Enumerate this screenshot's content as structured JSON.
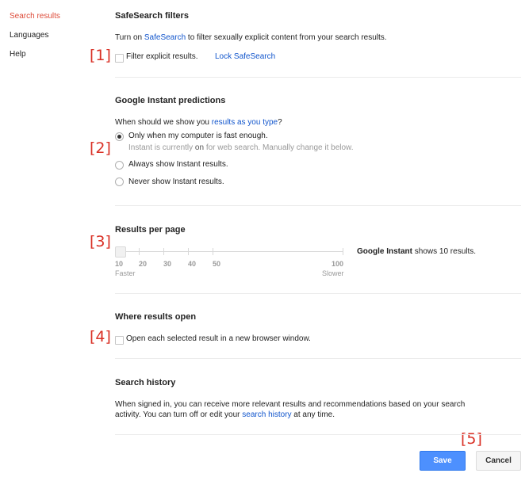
{
  "sidebar": {
    "items": [
      {
        "label": "Search results"
      },
      {
        "label": "Languages"
      },
      {
        "label": "Help"
      }
    ]
  },
  "markers": [
    "[1]",
    "[2]",
    "[3]",
    "[4]",
    "[5]"
  ],
  "safesearch": {
    "title": "SafeSearch filters",
    "desc_prefix": "Turn on ",
    "desc_link": "SafeSearch",
    "desc_suffix": " to filter sexually explicit content from your search results.",
    "checkbox_label": "Filter explicit results.",
    "lock_link": "Lock SafeSearch"
  },
  "instant": {
    "title": "Google Instant predictions",
    "question_prefix": "When should we show you ",
    "question_link": "results as you type",
    "question_suffix": "?",
    "options": [
      {
        "label": "Only when my computer is fast enough.",
        "selected": true
      },
      {
        "label": "Always show Instant results.",
        "selected": false
      },
      {
        "label": "Never show Instant results.",
        "selected": false
      }
    ],
    "note_prefix": "Instant is currently ",
    "note_strong": "on",
    "note_suffix": " for web search. Manually change it below."
  },
  "results_per_page": {
    "title": "Results per page",
    "ticks": [
      "10",
      "20",
      "30",
      "40",
      "50",
      "100"
    ],
    "left_label": "Faster",
    "right_label": "Slower",
    "selected_value": "10",
    "note_strong": "Google Instant",
    "note_suffix": " shows 10 results."
  },
  "where_open": {
    "title": "Where results open",
    "checkbox_label": "Open each selected result in a new browser window."
  },
  "history": {
    "title": "Search history",
    "line1": "When signed in, you can receive more relevant results and recommendations based on your search",
    "line2_prefix": "activity. You can turn off or edit your ",
    "line2_link": "search history",
    "line2_suffix": " at any time."
  },
  "footer": {
    "save_label": "Save",
    "cancel_label": "Cancel"
  },
  "colors": {
    "accent": "#dd4b39",
    "link": "#1155cc",
    "primary_button": "#4d90fe",
    "marker": "#d93025"
  }
}
